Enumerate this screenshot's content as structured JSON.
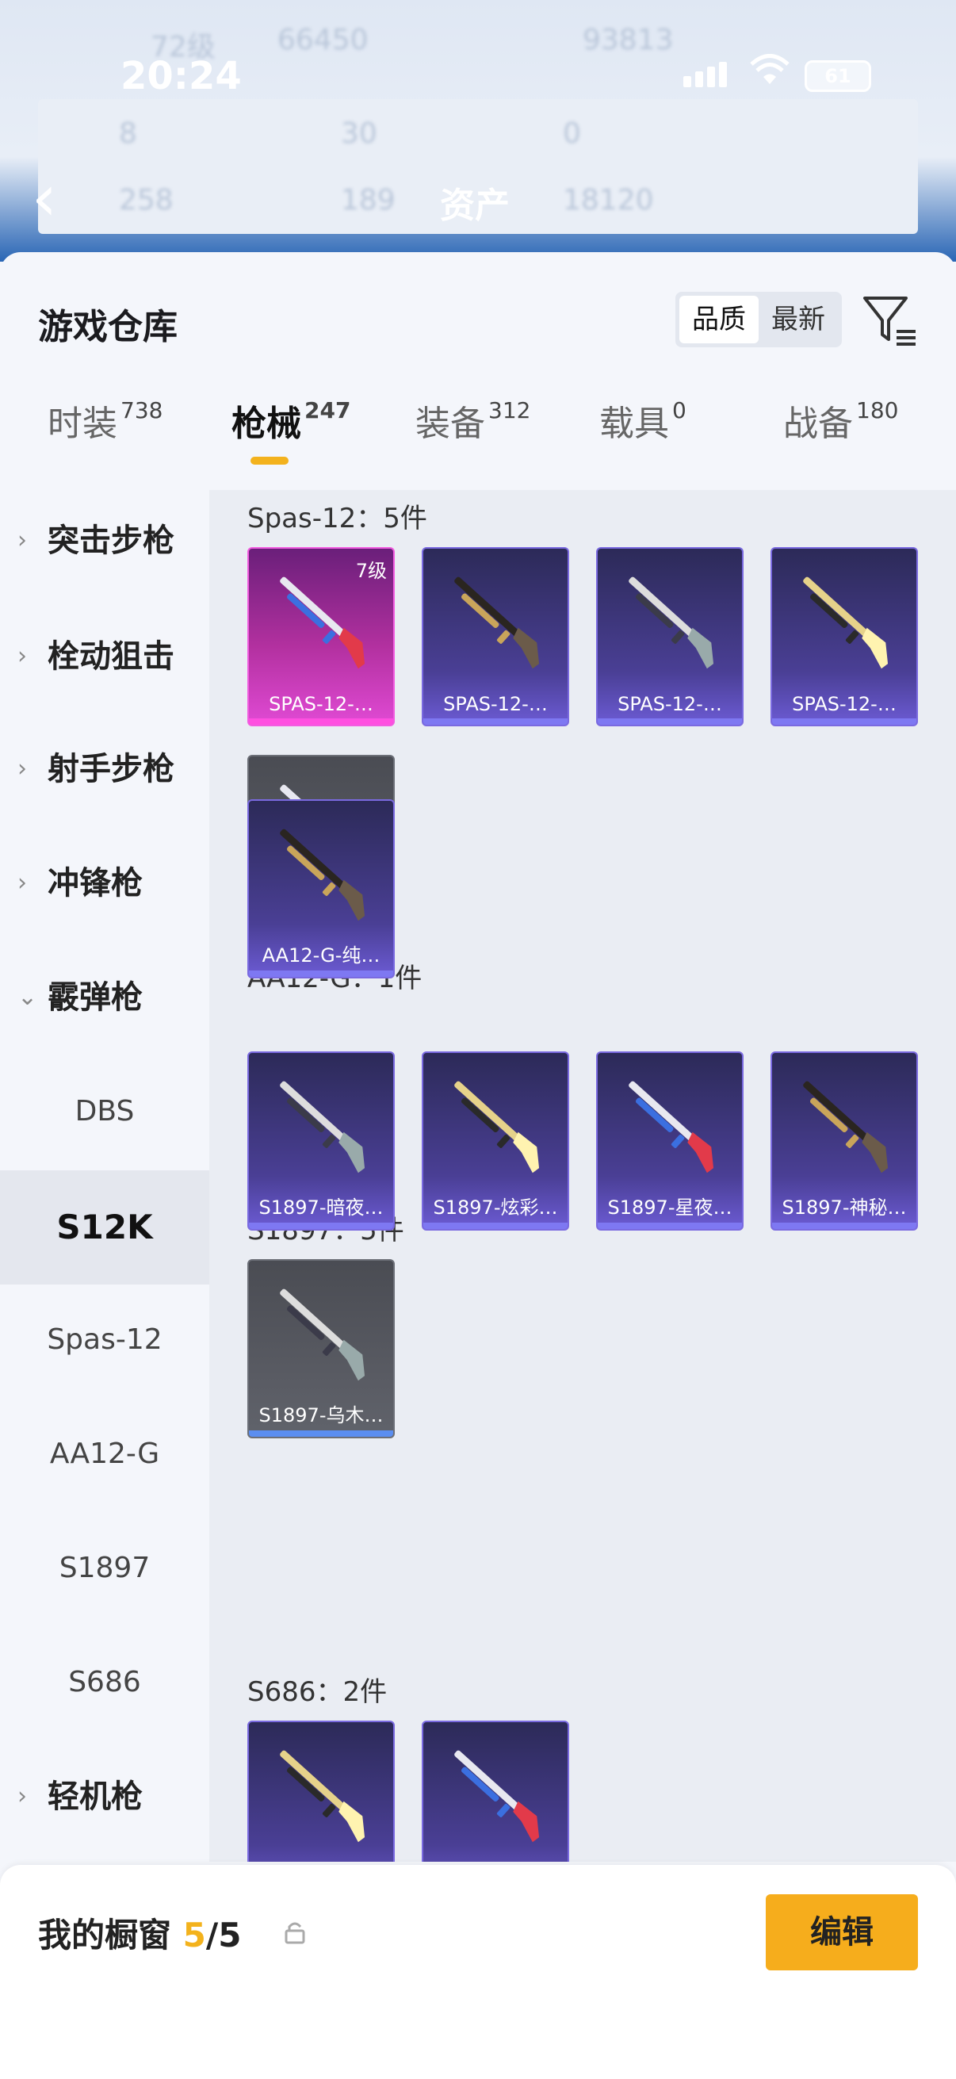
{
  "status_bar": {
    "time": "20:24",
    "battery": "61"
  },
  "background_header": {
    "level": "72级",
    "coins": "66450",
    "score": "93813",
    "stats_row1": [
      "8",
      "30",
      "0"
    ],
    "stats_row2": [
      "258",
      "189",
      "18120"
    ],
    "page_title": "资产"
  },
  "header": {
    "title": "游戏仓库",
    "sort_options": [
      "品质",
      "最新"
    ],
    "selected_sort": "品质"
  },
  "tabs": [
    {
      "label": "时装",
      "count": "738"
    },
    {
      "label": "枪械",
      "count": "247",
      "active": true
    },
    {
      "label": "装备",
      "count": "312"
    },
    {
      "label": "载具",
      "count": "0"
    },
    {
      "label": "战备",
      "count": "180"
    }
  ],
  "sidebar": [
    {
      "label": "突击步枪",
      "type": "category",
      "expanded": false
    },
    {
      "label": "栓动狙击",
      "type": "category",
      "expanded": false
    },
    {
      "label": "射手步枪",
      "type": "category",
      "expanded": false
    },
    {
      "label": "冲锋枪",
      "type": "category",
      "expanded": false
    },
    {
      "label": "霰弹枪",
      "type": "category",
      "expanded": true
    },
    {
      "label": "DBS",
      "type": "sub"
    },
    {
      "label": "S12K",
      "type": "sub",
      "selected": true
    },
    {
      "label": "Spas-12",
      "type": "sub"
    },
    {
      "label": "AA12-G",
      "type": "sub"
    },
    {
      "label": "S1897",
      "type": "sub"
    },
    {
      "label": "S686",
      "type": "sub"
    },
    {
      "label": "轻机枪",
      "type": "category",
      "expanded": false
    }
  ],
  "groups": [
    {
      "title": "Spas-12：5件",
      "items": [
        {
          "name": "SPAS-12-…",
          "rarity": "pink",
          "level": "7级"
        },
        {
          "name": "SPAS-12-…",
          "rarity": "purple"
        },
        {
          "name": "SPAS-12-…",
          "rarity": "purple"
        },
        {
          "name": "SPAS-12-…",
          "rarity": "purple"
        },
        {
          "name": "SPAS-12-…",
          "rarity": "gray"
        }
      ]
    },
    {
      "title": "AA12-G：1件",
      "items": [
        {
          "name": "AA12-G-纯…",
          "rarity": "purple"
        }
      ]
    },
    {
      "title": "S1897：5件",
      "items": [
        {
          "name": "S1897-暗夜…",
          "rarity": "purple"
        },
        {
          "name": "S1897-炫彩…",
          "rarity": "purple"
        },
        {
          "name": "S1897-星夜…",
          "rarity": "purple"
        },
        {
          "name": "S1897-神秘…",
          "rarity": "purple"
        },
        {
          "name": "S1897-乌木…",
          "rarity": "gray"
        }
      ]
    },
    {
      "title": "S686：2件",
      "items": [
        {
          "name": "",
          "rarity": "purple"
        },
        {
          "name": "",
          "rarity": "purple"
        }
      ]
    }
  ],
  "bottom_bar": {
    "label": "我的橱窗",
    "count": "5",
    "total": "/5",
    "edit_label": "编辑"
  },
  "colors": {
    "accent": "#f3b21d",
    "purple_rarity": "#6c5bd4",
    "pink_rarity": "#e04ad4",
    "gray_rarity": "#5a5c64"
  }
}
